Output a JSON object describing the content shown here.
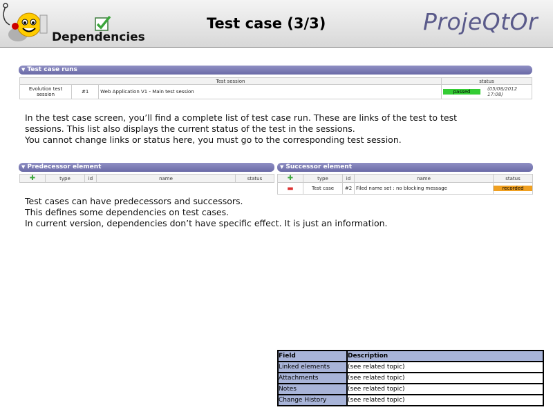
{
  "header": {
    "section_label": "Dependencies",
    "title": "Test case (3/3)",
    "brand": "ProjeQtOr"
  },
  "test_case_runs": {
    "title": "Test case runs",
    "columns": [
      "Test session",
      "status"
    ],
    "rows": [
      {
        "name": "Evolution test session",
        "id": "#1",
        "session": "Web Application V1 - Main test session",
        "status": "passed",
        "date": "(05/08/2012 17:08)"
      }
    ]
  },
  "paragraph1": {
    "line1": "In the test case screen, you’ll find a complete list of test case run. These are links of the test to test",
    "line2": "sessions. This list also displays the current status of the test in the sessions.",
    "line3": "You cannot change links or status here, you must go to the corresponding test session."
  },
  "predecessor": {
    "title": "Predecessor element",
    "columns": [
      "type",
      "id",
      "name",
      "status"
    ]
  },
  "successor": {
    "title": "Successor element",
    "columns": [
      "type",
      "id",
      "name",
      "status"
    ],
    "rows": [
      {
        "type": "Test case",
        "id": "#2",
        "name": "Filed name set : no blocking message",
        "status": "recorded"
      }
    ]
  },
  "paragraph2": {
    "line1": "Test cases can have predecessors and successors.",
    "line2": "This defines some dependencies on test cases.",
    "line3": "In current version, dependencies don’t have specific effect. It is just an information."
  },
  "fields_table": {
    "header": [
      "Field",
      "Description"
    ],
    "rows": [
      [
        "Linked elements",
        "(see related topic)"
      ],
      [
        "Attachments",
        "(see related topic)"
      ],
      [
        "Notes",
        "(see related topic)"
      ],
      [
        "Change History",
        "(see related topic)"
      ]
    ]
  },
  "colors": {
    "passed": "#33cc33",
    "recorded": "#f0a020",
    "panel": "#7a7ab4",
    "field_cell": "#a8b4d8"
  },
  "icons": [
    "smiley-logo-icon",
    "check-icon",
    "add-icon",
    "remove-icon",
    "collapse-arrow-icon"
  ]
}
